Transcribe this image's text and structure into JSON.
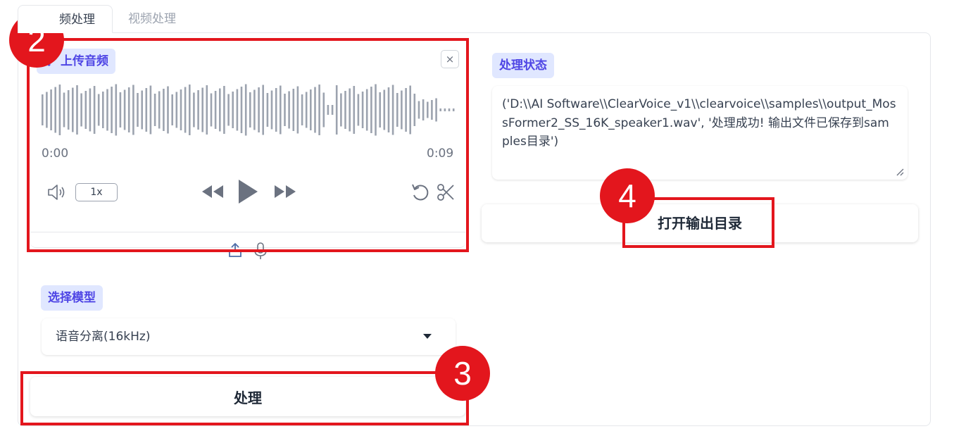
{
  "tabs": [
    {
      "label": "频处理",
      "active": true
    },
    {
      "label": "视频处理",
      "active": false
    }
  ],
  "audio": {
    "label": "上传音频",
    "close_icon": "×",
    "time_start": "0:00",
    "time_end": "0:09",
    "speed": "1x",
    "icons": [
      "music-icon",
      "close-icon",
      "volume-icon",
      "rewind-icon",
      "play-icon",
      "forward-icon",
      "undo-icon",
      "scissors-icon",
      "upload-icon",
      "microphone-icon"
    ]
  },
  "model": {
    "label": "选择模型",
    "selected": "语音分离(16kHz)"
  },
  "process_button": "处理",
  "status": {
    "label": "处理状态",
    "text": "('D:\\\\AI Software\\\\ClearVoice_v1\\\\clearvoice\\\\samples\\\\output_MossFormer2_SS_16K_speaker1.wav', '处理成功! 输出文件已保存到samples目录')"
  },
  "open_output_button": "打开输出目录",
  "annotations": [
    "2",
    "3",
    "4"
  ],
  "colors": {
    "accent": "#4f46e5",
    "chip_bg": "#e0e7ff",
    "annotation_red": "#e3161d"
  }
}
